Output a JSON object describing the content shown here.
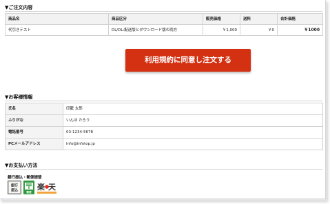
{
  "order": {
    "title": "▼ご注文内容",
    "headers": [
      "商品名",
      "商品区分",
      "販売価格",
      "送料",
      "合計価格"
    ],
    "row": {
      "name": "代引きテスト",
      "category": "DL/DL:配送版とダウンロード版の両方",
      "price": "￥1,000",
      "shipping": "￥0",
      "total": "￥1000"
    }
  },
  "cta": {
    "label": "利用規約に同意し注文する",
    "color": "#d43113"
  },
  "customer": {
    "title": "▼お客様情報",
    "rows": [
      {
        "label": "氏名",
        "value": "印籠 太郎"
      },
      {
        "label": "ふりがな",
        "value": "いんほ たろう"
      },
      {
        "label": "電話番号",
        "value": "03-1234-5678"
      },
      {
        "label": "PCメールアドレス",
        "value": "info@infotop.jp"
      }
    ]
  },
  "payment": {
    "title": "▼お支払い方法",
    "method": "銀行振込・郵便振替",
    "icons": [
      "bank-transfer-icon",
      "japan-post-icon",
      "rakuten-icon"
    ],
    "icon_texts": {
      "bank": "銀行振込",
      "post": "郵便",
      "rakuten": "楽天"
    }
  }
}
